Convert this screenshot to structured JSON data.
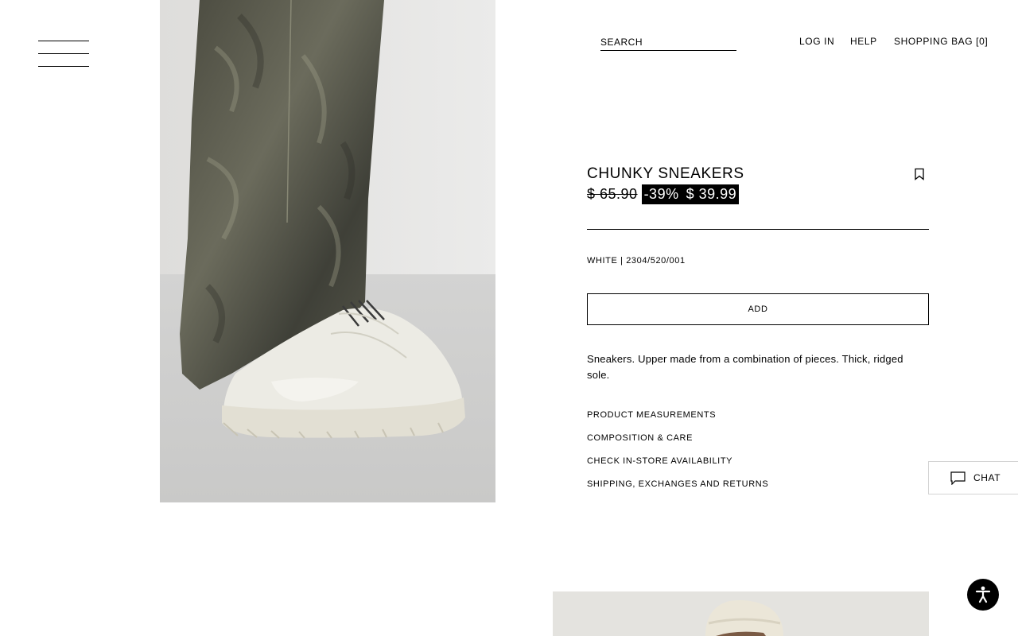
{
  "header": {
    "search_placeholder": "SEARCH",
    "login": "LOG IN",
    "help": "HELP",
    "bag": "SHOPPING BAG [0]"
  },
  "product": {
    "title": "CHUNKY SNEAKERS",
    "old_price": "$ 65.90",
    "discount": "-39%",
    "price": "$ 39.99",
    "color_ref": "WHITE | 2304/520/001",
    "add_label": "ADD",
    "description": "Sneakers. Upper made from a combination of pieces. Thick, ridged sole.",
    "links": [
      "PRODUCT MEASUREMENTS",
      "COMPOSITION & CARE",
      "CHECK IN-STORE AVAILABILITY",
      "SHIPPING, EXCHANGES AND RETURNS"
    ]
  },
  "chat": {
    "label": "CHAT"
  },
  "icons": {
    "menu": "hamburger-menu-icon",
    "bookmark": "bookmark-icon",
    "chat": "chat-bubble-icon",
    "accessibility": "accessibility-icon"
  },
  "colors": {
    "text": "#000000",
    "background": "#ffffff",
    "sale_bg": "#000000",
    "sale_text": "#ffffff"
  }
}
